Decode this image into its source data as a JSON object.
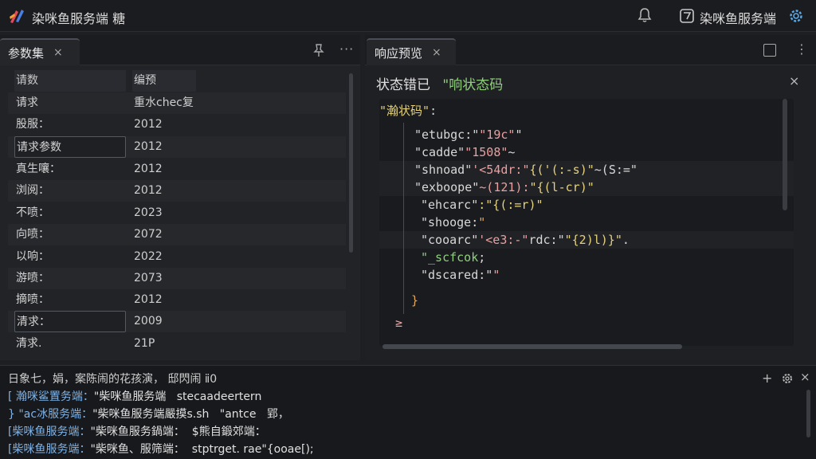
{
  "app": {
    "title": "染咪鱼服务端 糖",
    "right_title": "染咪鱼服务端"
  },
  "colors": {
    "accent": "#8fcf7c",
    "string": "#e8a0a0",
    "value": "#e6d27a",
    "punct": "#e5a45a",
    "link": "#7fb2e5"
  },
  "icons": {
    "logo": "app-logo-icon",
    "bell": "bell-icon",
    "settings": "gear-icon",
    "close": "close-icon",
    "pin": "pin-icon",
    "more": "more-icon",
    "plus": "plus-icon",
    "split": "split-view-icon"
  },
  "left_panel": {
    "tab_label": "参数集",
    "close_glyph": "×",
    "more_glyph": "···",
    "table": {
      "headers": [
        "请数",
        "编预"
      ],
      "rows": [
        [
          "请求",
          "重水chec复"
        ],
        [
          "股服：",
          "2012"
        ],
        [
          "请求参数",
          "2012"
        ],
        [
          "真生嚷：",
          "2012"
        ],
        [
          "浏阅：",
          "2012"
        ],
        [
          "不喷：",
          "2023"
        ],
        [
          "向喷：",
          "2072"
        ],
        [
          "以响：",
          "2022"
        ],
        [
          "游喷：",
          "2073"
        ],
        [
          "摘喷：",
          "2012"
        ],
        [
          "清求：",
          "2009"
        ],
        [
          "清求.",
          "21P"
        ]
      ]
    }
  },
  "right_panel": {
    "tab_label": "响应预览",
    "close_glyph": "×",
    "more_glyph": "⋮",
    "status_label": "状态错已",
    "status_value": "\"响状态码",
    "code": {
      "l0": [
        "\"瀚状码\"",
        ":"
      ],
      "l1": [
        "\"etubgc:\"",
        "\"19c\"",
        "\""
      ],
      "l2": [
        "\"cadde\"",
        "\"1508\"",
        "~"
      ],
      "l3": [
        "\"shnoad\"",
        "'<54dr:\"",
        "{('(:-s)\"",
        "~(S:=\""
      ],
      "l4": [
        "\"exboope\"",
        "~(121):",
        "\"{(l-cr)\""
      ],
      "l5": [
        "\"ehcarc\"",
        ":\"{(:=r)\""
      ],
      "l6": [
        "\"shooge:",
        "\""
      ],
      "l7": [
        "\"cooarc\"",
        "'<e3:-\"",
        "rdc:\"",
        "\"{2)l)}\"",
        "."
      ],
      "l8": [
        "\"_scfcok",
        ";"
      ],
      "l9": [
        "\"dscared:\"",
        "\""
      ],
      "l10": [
        "}"
      ],
      "l11": [
        "≥"
      ]
    }
  },
  "console": {
    "header": "日象七，娟，案陈闹的花孩演，  邸閃闹  ⅱ0",
    "plus_glyph": "+",
    "close_glyph": "×",
    "lines": [
      {
        "prefix": "[ 瀚咪鲨置务端：",
        "body": "\"柴咪鱼服务端   stecaadeertern"
      },
      {
        "prefix": "} \"ac冰服务端：",
        "body": "\"柴咪鱼服务端嚴摸s.sh   \"antce   郢，"
      },
      {
        "prefix": "[柴咪鱼服务端：",
        "body": "\"柴咪鱼服务鍋端：  $熊自鍛郊端："
      },
      {
        "prefix": "[柴咪鱼服务端：",
        "body": "\"柴咪鱼、服筛端：  stptrget. rae\"{ooae[);"
      }
    ]
  }
}
